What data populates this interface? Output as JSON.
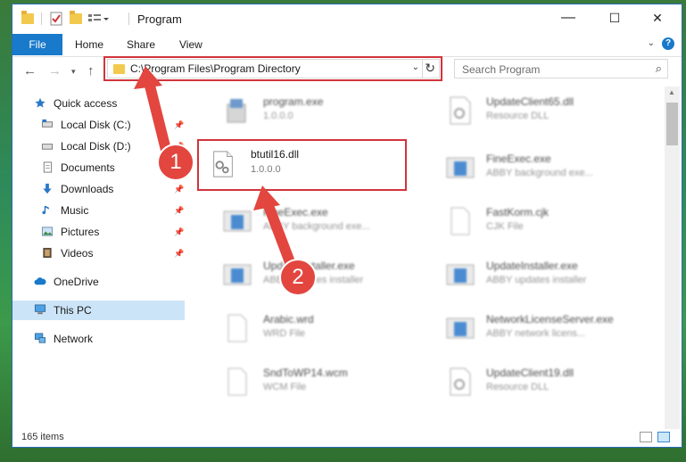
{
  "window": {
    "title": "Program",
    "controls": {
      "minimize": "—",
      "maximize": "☐",
      "close": "✕"
    }
  },
  "ribbon": {
    "file_tab": "File",
    "tabs": [
      "Home",
      "Share",
      "View"
    ]
  },
  "address": {
    "path": "C:\\Program Files\\Program Directory",
    "search_placeholder": "Search Program"
  },
  "sidebar": {
    "items": [
      {
        "label": "Quick access",
        "icon": "star-icon"
      },
      {
        "label": "Local Disk (C:)",
        "icon": "drive-icon",
        "pinned": true
      },
      {
        "label": "Local Disk (D:)",
        "icon": "drive-icon",
        "pinned": true
      },
      {
        "label": "Documents",
        "icon": "documents-icon",
        "pinned": true
      },
      {
        "label": "Downloads",
        "icon": "download-icon",
        "pinned": true
      },
      {
        "label": "Music",
        "icon": "music-icon",
        "pinned": true
      },
      {
        "label": "Pictures",
        "icon": "pictures-icon",
        "pinned": true
      },
      {
        "label": "Videos",
        "icon": "videos-icon",
        "pinned": true
      },
      {
        "label": "OneDrive",
        "icon": "cloud-icon"
      },
      {
        "label": "This PC",
        "icon": "computer-icon",
        "selected": true
      },
      {
        "label": "Network",
        "icon": "network-icon"
      }
    ]
  },
  "files": [
    {
      "name": "program.exe",
      "desc": "1.0.0.0",
      "icon": "program-icon"
    },
    {
      "name": "UpdateClient65.dll",
      "desc": "Resource DLL",
      "icon": "dll-icon"
    },
    {
      "name": "btutil16.dll",
      "desc": "1.0.0.0",
      "icon": "gear-dll-icon"
    },
    {
      "name": "FineExec.exe",
      "desc": "ABBY background exe...",
      "icon": "app-window-icon"
    },
    {
      "name": "FineExec.exe",
      "desc": "ABBY background exe...",
      "icon": "app-window-icon"
    },
    {
      "name": "FastKorm.cjk",
      "desc": "CJK File",
      "icon": "blank-file-icon"
    },
    {
      "name": "UpdateInstaller.exe",
      "desc": "ABBY updates installer",
      "icon": "app-window-icon"
    },
    {
      "name": "UpdateInstaller.exe",
      "desc": "ABBY updates installer",
      "icon": "app-window-icon"
    },
    {
      "name": "Arabic.wrd",
      "desc": "WRD File",
      "icon": "blank-file-icon"
    },
    {
      "name": "NetworkLicenseServer.exe",
      "desc": "ABBY network licens...",
      "icon": "app-window-icon"
    },
    {
      "name": "SndToWP14.wcm",
      "desc": "WCM File",
      "icon": "blank-file-icon"
    },
    {
      "name": "UpdateClient19.dll",
      "desc": "Resource DLL",
      "icon": "dll-icon"
    }
  ],
  "status": {
    "count": "165 items"
  },
  "callouts": [
    "1",
    "2"
  ],
  "colors": {
    "accent": "#1979ca",
    "highlight": "#d1343c",
    "arrow": "#e2463f"
  }
}
